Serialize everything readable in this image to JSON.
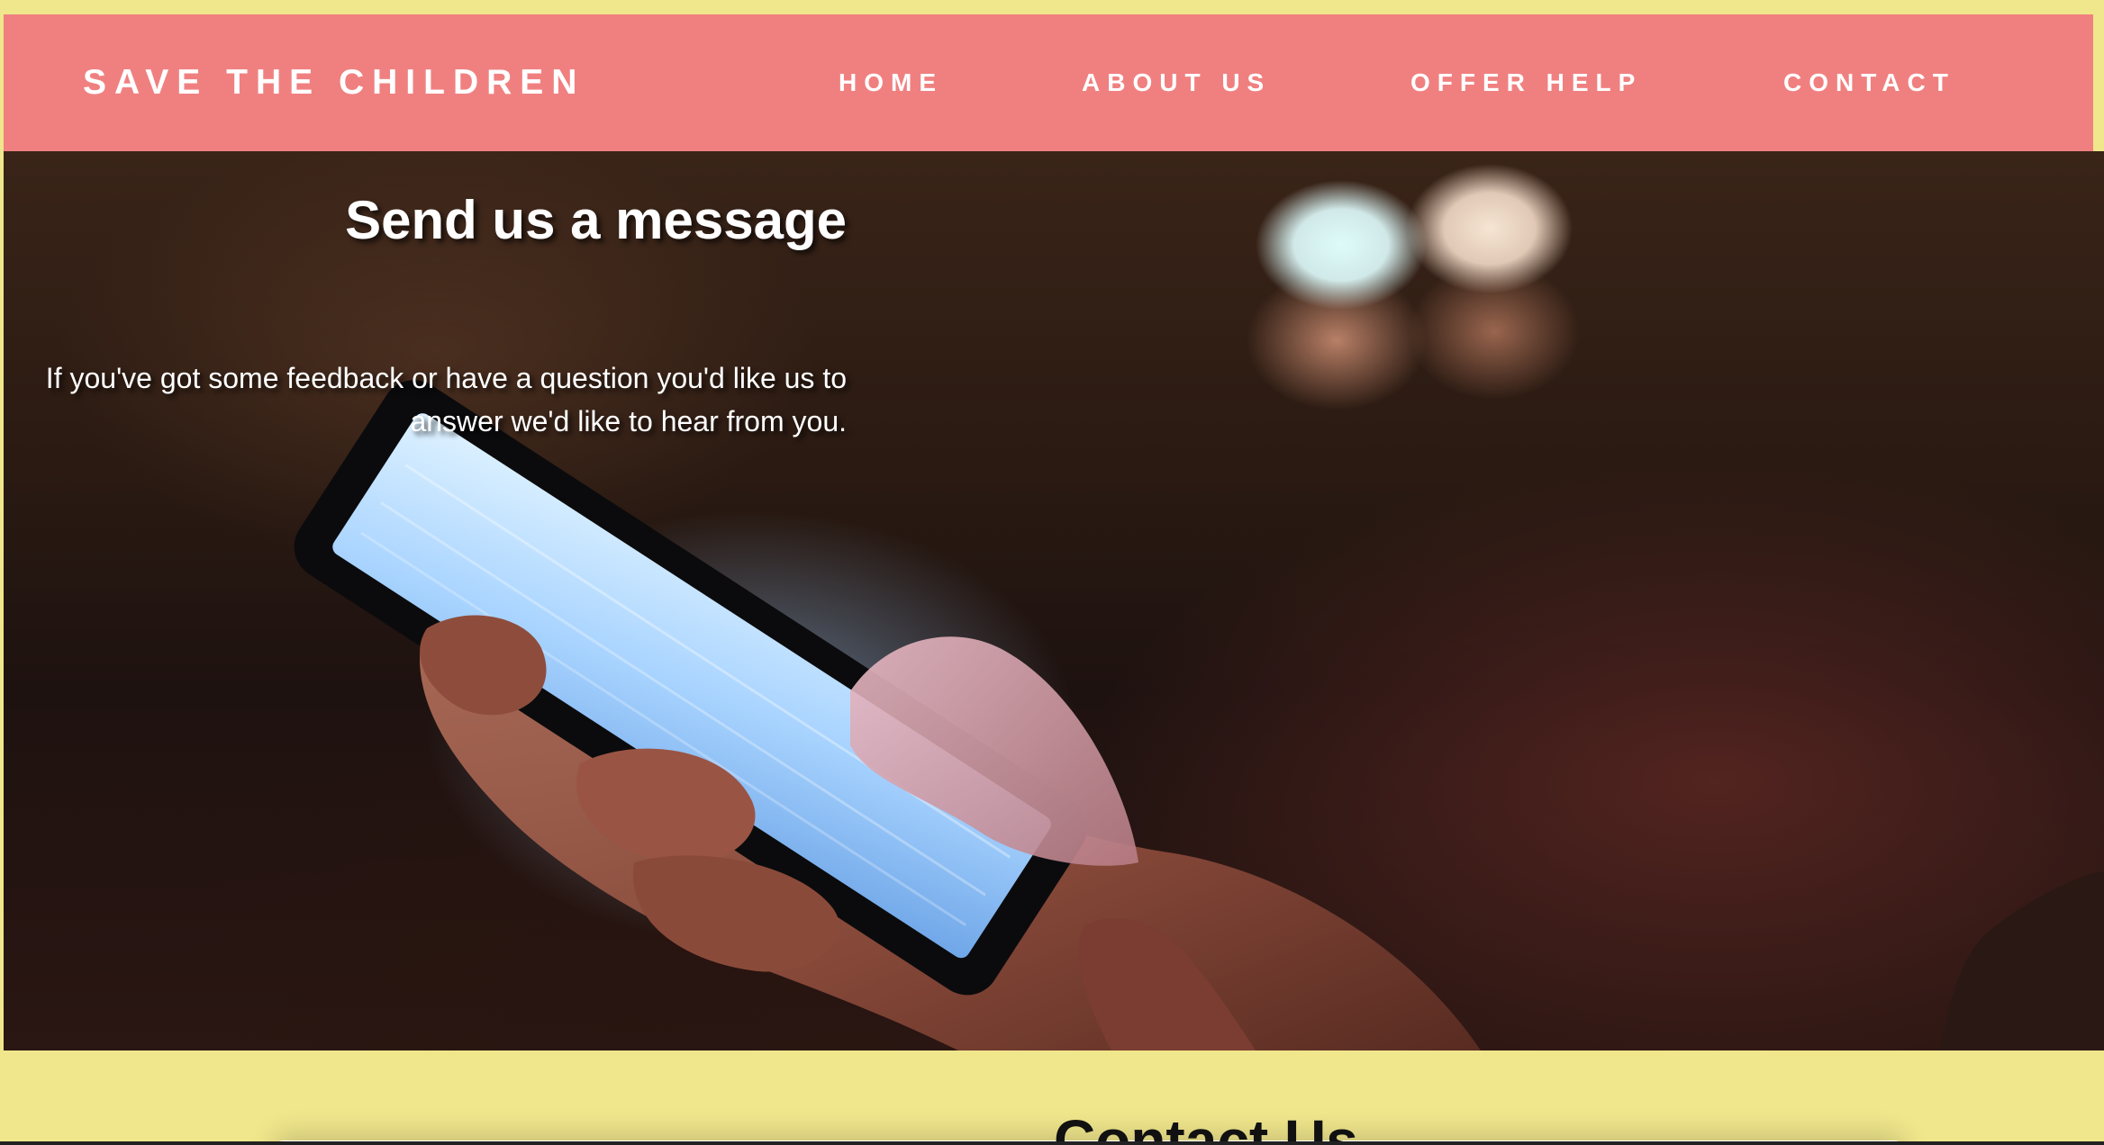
{
  "header": {
    "brand": "SAVE THE CHILDREN",
    "nav": [
      {
        "label": "HOME"
      },
      {
        "label": "ABOUT US"
      },
      {
        "label": "OFFER HELP"
      },
      {
        "label": "CONTACT"
      }
    ]
  },
  "hero": {
    "title": "Send us a message",
    "text": "If you've got some feedback or have a question you'd like us to answer we'd like to hear from you.",
    "image": "hands-holding-smartphone-photo"
  },
  "contact_section": {
    "heading": "Contact Us"
  },
  "colors": {
    "header_bg": "#f08080",
    "page_bg": "#f0e68c",
    "text_light": "#ffffff"
  }
}
